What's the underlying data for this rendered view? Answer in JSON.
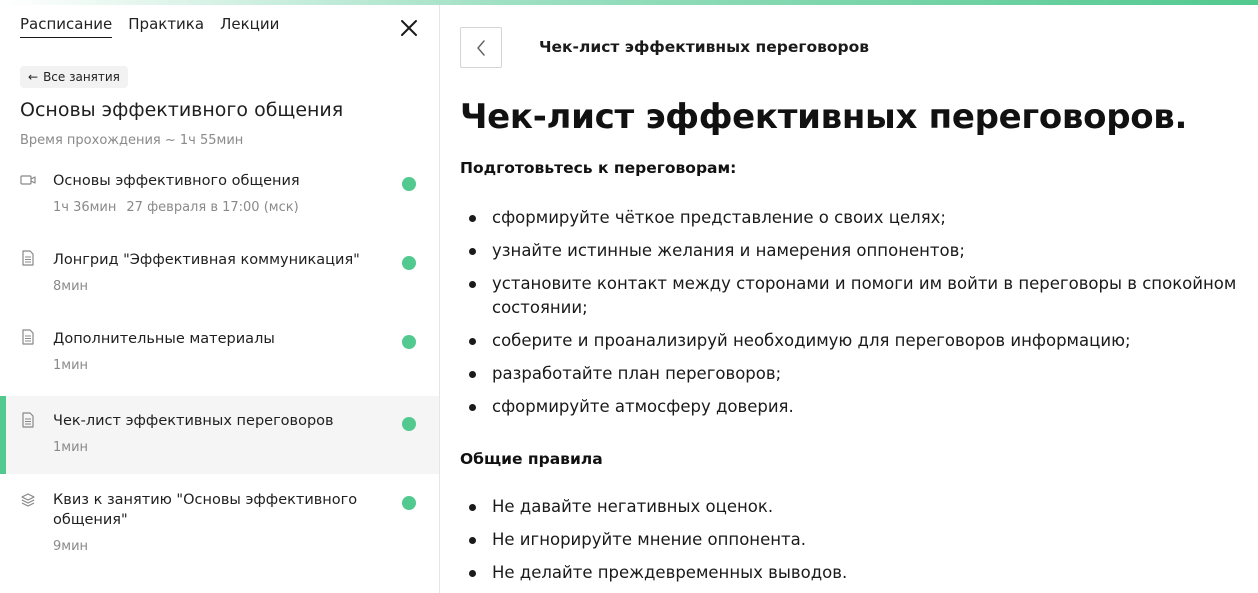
{
  "sidebar": {
    "tabs": [
      {
        "label": "Расписание"
      },
      {
        "label": "Практика"
      },
      {
        "label": "Лекции"
      }
    ],
    "back_label": "Все занятия",
    "course_title": "Основы эффективного общения",
    "course_time": "Время прохождения ~ 1ч 55мин",
    "lessons": [
      {
        "title": "Основы эффективного общения",
        "duration": "1ч 36мин",
        "date": "27 февраля в 17:00 (мск)",
        "icon": "video-camera-icon",
        "status": "completed"
      },
      {
        "title": "Лонгрид \"Эффективная коммуникация\"",
        "duration": "8мин",
        "icon": "document-icon",
        "status": "completed"
      },
      {
        "title": "Дополнительные материалы",
        "duration": "1мин",
        "icon": "document-icon",
        "status": "completed"
      },
      {
        "title": "Чек-лист эффективных переговоров",
        "duration": "1мин",
        "icon": "document-icon",
        "status": "completed",
        "active": true
      },
      {
        "title": "Квиз к занятию \"Основы эффективного общения\"",
        "duration": "9мин",
        "icon": "layers-icon",
        "status": "completed"
      }
    ]
  },
  "main": {
    "header_title": "Чек-лист эффективных переговоров",
    "doc_title": "Чек-лист эффективных переговоров.",
    "section1": {
      "heading": "Подготовьтесь к переговорам:",
      "items": [
        "сформируйте чёткое представление о своих целях;",
        "узнайте истинные желания и намерения оппонентов;",
        "установите контакт между сторонами и помоги им войти в переговоры в спокойном состоянии;",
        "соберите и проанализируй необходимую для переговоров информацию;",
        "разработайте план переговоров;",
        "сформируйте атмосферу доверия."
      ]
    },
    "section2": {
      "heading": "Общие правила",
      "items": [
        "Не давайте негативных оценок.",
        "Не игнорируйте мнение оппонента.",
        "Не делайте преждевременных выводов."
      ]
    }
  },
  "colors": {
    "accent": "#52c98f",
    "muted_text": "#8a8a8a",
    "active_bg": "#f5f5f5"
  }
}
